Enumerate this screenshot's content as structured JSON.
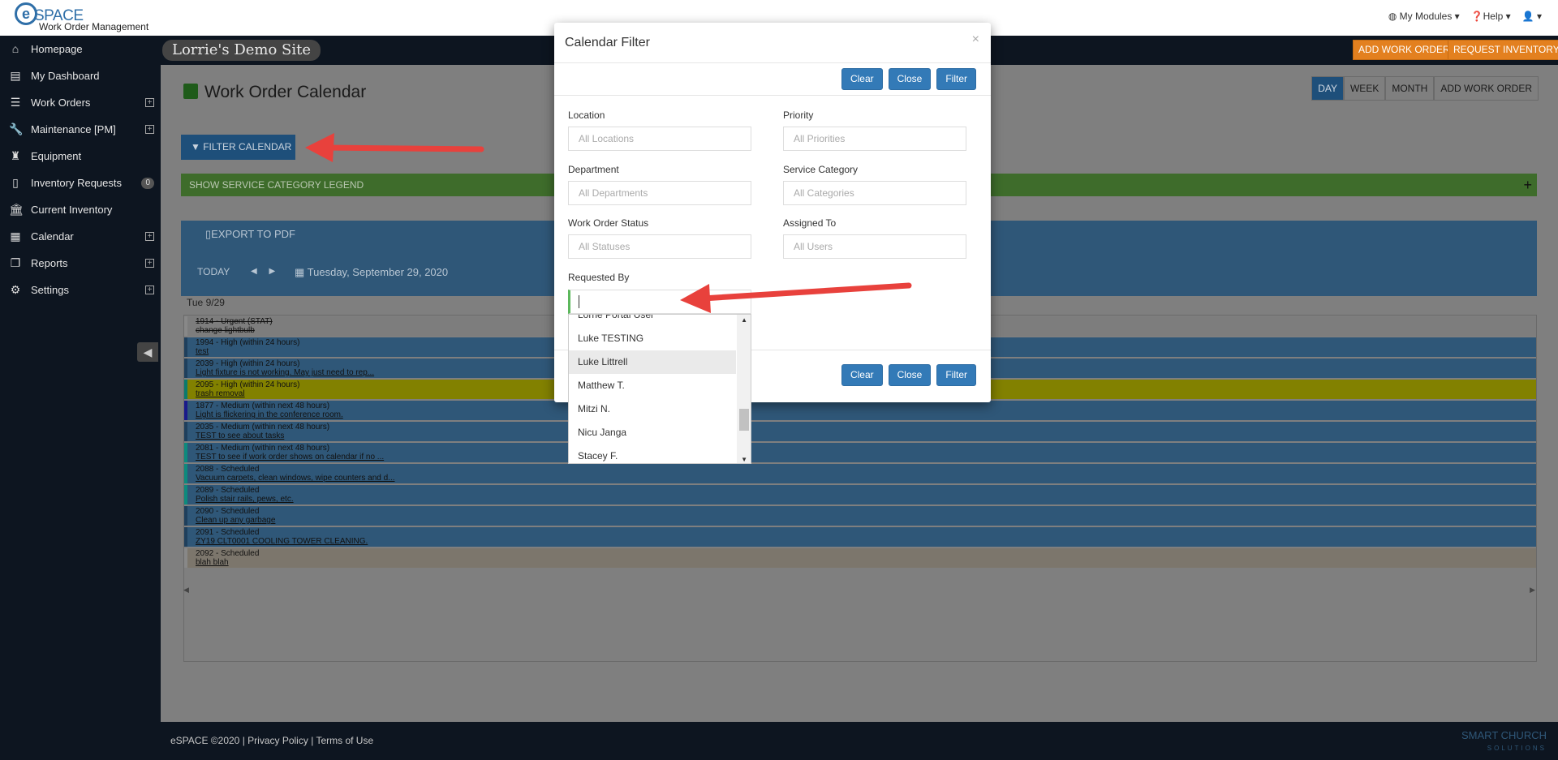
{
  "brand": {
    "logo_letter": "e",
    "name": "SPACE",
    "subtitle": "Work Order Management"
  },
  "topnav": {
    "modules": "My Modules",
    "help": "Help",
    "user": ""
  },
  "site": {
    "name": "Lorrie's Demo Site",
    "add_work_order": "ADD WORK ORDER",
    "request_inventory": "REQUEST INVENTORY"
  },
  "sidebar": {
    "items": [
      {
        "label": "Homepage",
        "icon": "home-icon"
      },
      {
        "label": "My Dashboard",
        "icon": "dashboard-icon"
      },
      {
        "label": "Work Orders",
        "icon": "list-icon",
        "expand": "+"
      },
      {
        "label": "Maintenance [PM]",
        "icon": "wrench-icon",
        "expand": "+"
      },
      {
        "label": "Equipment",
        "icon": "equipment-icon"
      },
      {
        "label": "Inventory Requests",
        "icon": "document-icon",
        "badge": "0"
      },
      {
        "label": "Current Inventory",
        "icon": "bank-icon"
      },
      {
        "label": "Calendar",
        "icon": "calendar-icon",
        "expand": "+"
      },
      {
        "label": "Reports",
        "icon": "reports-icon",
        "expand": "+"
      },
      {
        "label": "Settings",
        "icon": "gear-icon",
        "expand": "+"
      }
    ]
  },
  "page": {
    "title": "Work Order Calendar",
    "views": {
      "day": "DAY",
      "week": "WEEK",
      "month": "MONTH",
      "add": "ADD WORK ORDER"
    },
    "filter_button": "FILTER CALENDAR",
    "legend": "SHOW SERVICE CATEGORY LEGEND",
    "export": "EXPORT TO PDF",
    "today": "TODAY",
    "date": "Tuesday, September 29, 2020",
    "day_label": "Tue 9/29"
  },
  "events": [
    {
      "title": "1914 - Urgent (STAT)",
      "desc": "change lightbulb",
      "style": "ev-white ev-strike"
    },
    {
      "title": "1994 - High (within 24 hours)",
      "desc": "test",
      "style": "ev-blue"
    },
    {
      "title": "2039 - High (within 24 hours)",
      "desc": "Light fixture is not working. May just need to rep...",
      "style": "ev-blue"
    },
    {
      "title": "2095 - High (within 24 hours)",
      "desc": "trash removal",
      "style": "ev-yellow"
    },
    {
      "title": "1877 - Medium (within next 48 hours)",
      "desc": "Light is flickering in the conference room.",
      "style": "ev-navy"
    },
    {
      "title": "2035 - Medium (within next 48 hours)",
      "desc": "TEST to see about tasks",
      "style": "ev-blue"
    },
    {
      "title": "2081 - Medium (within next 48 hours)",
      "desc": "TEST to see if work order shows on calendar if no ...",
      "style": "ev-teal"
    },
    {
      "title": "2088 - Scheduled",
      "desc": "Vacuum carpets, clean windows, wipe counters and d...",
      "style": "ev-teal"
    },
    {
      "title": "2089 - Scheduled",
      "desc": "Polish stair rails, pews, etc.",
      "style": "ev-teal"
    },
    {
      "title": "2090 - Scheduled",
      "desc": "Clean up any garbage",
      "style": "ev-blue"
    },
    {
      "title": "2091 - Scheduled",
      "desc": "ZY19 CLT0001 COOLING TOWER CLEANING.",
      "style": "ev-blue"
    },
    {
      "title": "2092 - Scheduled",
      "desc": "blah blah",
      "style": "ev-tan"
    }
  ],
  "footer": {
    "copyright": "eSPACE ©2020",
    "privacy": "Privacy Policy",
    "terms": "Terms of Use",
    "sep": "|",
    "logo_line1": "SMART CHURCH",
    "logo_line2": "SOLUTIONS"
  },
  "modal": {
    "title": "Calendar Filter",
    "close_x": "×",
    "buttons": {
      "clear": "Clear",
      "close": "Close",
      "filter": "Filter"
    },
    "fields": {
      "location": {
        "label": "Location",
        "placeholder": "All Locations"
      },
      "priority": {
        "label": "Priority",
        "placeholder": "All Priorities"
      },
      "department": {
        "label": "Department",
        "placeholder": "All Departments"
      },
      "service_category": {
        "label": "Service Category",
        "placeholder": "All Categories"
      },
      "status": {
        "label": "Work Order Status",
        "placeholder": "All Statuses"
      },
      "assigned_to": {
        "label": "Assigned To",
        "placeholder": "All Users"
      },
      "requested_by": {
        "label": "Requested By",
        "value": ""
      }
    },
    "dropdown_options": [
      "Lorrie Portal User",
      "Luke TESTING",
      "Luke Littrell",
      "Matthew T.",
      "Mitzi N.",
      "Nicu Janga",
      "Stacey F."
    ],
    "highlighted_option": "Luke Littrell"
  },
  "colors": {
    "accent": "#337ab7",
    "orange": "#e3801f",
    "arrow": "#e8413c",
    "dark_nav": "#0d1520"
  }
}
